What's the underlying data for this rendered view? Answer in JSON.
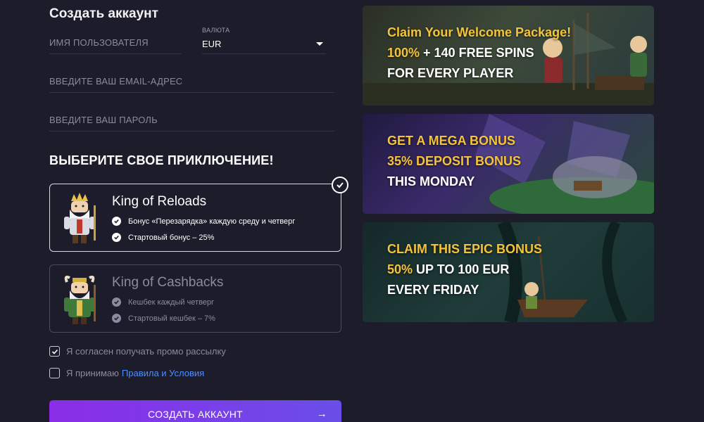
{
  "form": {
    "title": "Создать аккаунт",
    "username_placeholder": "ИМЯ ПОЛЬЗОВАТЕЛЯ",
    "currency_label": "ВАЛЮТА",
    "currency_value": "EUR",
    "email_placeholder": "ВВЕДИТЕ ВАШ EMAIL-АДРЕС",
    "password_placeholder": "ВВЕДИТЕ ВАШ ПАРОЛЬ"
  },
  "adventure": {
    "heading": "ВЫБЕРИТЕ СВОЕ ПРИКЛЮЧЕНИЕ!",
    "cards": [
      {
        "title": "King of Reloads",
        "features": [
          "Бонус «Перезарядка» каждую среду и четверг",
          "Стартовый бонус – 25%"
        ],
        "selected": true
      },
      {
        "title": "King of Cashbacks",
        "features": [
          "Кешбек каждый четверг",
          "Стартовый кешбек – 7%"
        ],
        "selected": false
      }
    ]
  },
  "consent": {
    "promo_label": "Я согласен получать промо рассылку",
    "promo_checked": true,
    "terms_prefix": "Я принимаю",
    "terms_link": "Правила и Условия",
    "terms_checked": false
  },
  "submit": {
    "label": "СОЗДАТЬ АККАУНТ",
    "icon": "arrow-right-icon"
  },
  "banners": [
    {
      "line1": "Claim Your Welcome Package!",
      "line2_highlight": "100%",
      "line2_rest": " + 140 FREE SPINS",
      "line3": "FOR EVERY PLAYER"
    },
    {
      "line1": "GET A MEGA BONUS",
      "line2_highlight": "35% DEPOSIT BONUS",
      "line2_rest": "",
      "line3": "THIS MONDAY"
    },
    {
      "line1": "CLAIM THIS EPIC BONUS",
      "line2_highlight": "50%",
      "line2_rest": " UP TO 100 EUR",
      "line3": "EVERY FRIDAY"
    }
  ],
  "colors": {
    "background": "#1c1c2a",
    "accent_gold": "#f5c33a",
    "link_blue": "#4f8cff",
    "button_gradient_start": "#8b2de8",
    "button_gradient_end": "#6a4ee8"
  }
}
